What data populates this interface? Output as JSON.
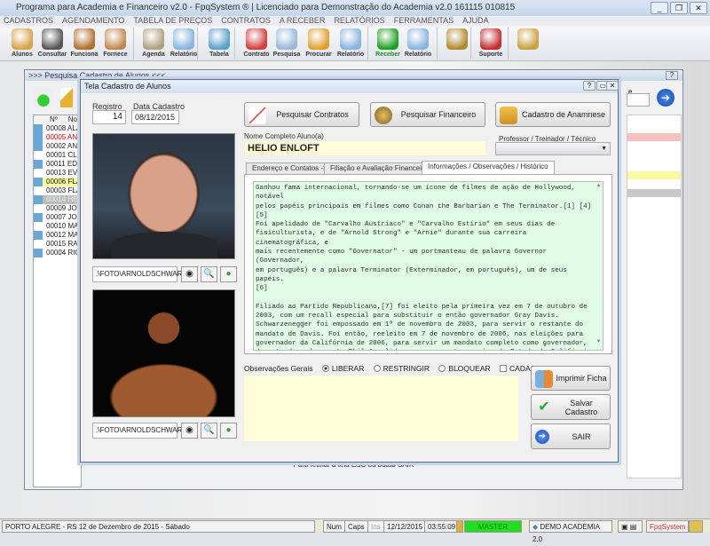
{
  "window": {
    "title": "Programa para Academia e Financeiro v2.0 - FpqSystem ® | Licenciado para  Demonstração do Academia v2.0 161115 010815"
  },
  "menu": [
    "CADASTROS",
    "AGENDAMENTO",
    "TABELA DE PREÇOS",
    "CONTRATOS",
    "A RECEBER",
    "RELATÓRIOS",
    "FERRAMENTAS",
    "AJUDA"
  ],
  "toolbar": [
    {
      "label": "Alunos",
      "icon": "students-icon",
      "color": "#d9a24a"
    },
    {
      "label": "Consultar",
      "icon": "id-card-icon",
      "color": "#555555"
    },
    {
      "label": "Funciona",
      "icon": "employees-icon",
      "color": "#b07030"
    },
    {
      "label": "Fornece",
      "icon": "supplier-icon",
      "color": "#c08850"
    },
    {
      "label": "Agenda",
      "icon": "clock-icon",
      "color": "#b0a080"
    },
    {
      "label": "Relatório",
      "icon": "printer-icon",
      "color": "#8ab4e0"
    },
    {
      "label": "Tabela",
      "icon": "document-icon",
      "color": "#5aa0c8"
    },
    {
      "label": "Contrato",
      "icon": "pen-icon",
      "color": "#d04040"
    },
    {
      "label": "Pesquisa",
      "icon": "magnifier-icon",
      "color": "#9ab8d8"
    },
    {
      "label": "Procurar",
      "icon": "folder-icon",
      "color": "#e0a030"
    },
    {
      "label": "Relatório",
      "icon": "printer-icon",
      "color": "#8ab4e0"
    },
    {
      "label": "Receber",
      "icon": "dollar-icon",
      "color": "#20a020"
    },
    {
      "label": "Relatório",
      "icon": "printer-icon",
      "color": "#8ab4e0"
    },
    {
      "label": "",
      "icon": "coins-icon",
      "color": "#b08830"
    },
    {
      "label": "Suporte",
      "icon": "support-icon",
      "color": "#c03030"
    },
    {
      "label": "",
      "icon": "exit-door-icon",
      "color": "#c8a040"
    }
  ],
  "search_window": {
    "title": ">>> Pesquisa Cadastro de Alunos <<<",
    "col_num": "Nº",
    "col_name": "Nom",
    "side_label": "e",
    "rows": [
      {
        "num": "00008",
        "name": "ALAN",
        "style": "normal"
      },
      {
        "num": "00005",
        "name": "ANAI",
        "style": "red"
      },
      {
        "num": "00002",
        "name": "ANGI",
        "style": "normal"
      },
      {
        "num": "00001",
        "name": "CLIEI",
        "style": "normal"
      },
      {
        "num": "00011",
        "name": "EDUA",
        "style": "normal"
      },
      {
        "num": "00013",
        "name": "EVER",
        "style": "normal"
      },
      {
        "num": "00006",
        "name": "FLAV",
        "style": "yellow"
      },
      {
        "num": "00003",
        "name": "FLAV",
        "style": "normal"
      },
      {
        "num": "00014",
        "name": "HELI",
        "style": "selected"
      },
      {
        "num": "00009",
        "name": "JOSE",
        "style": "normal"
      },
      {
        "num": "00007",
        "name": "JOÃO",
        "style": "normal"
      },
      {
        "num": "00010",
        "name": "MAIR",
        "style": "normal"
      },
      {
        "num": "00012",
        "name": "MATI",
        "style": "normal"
      },
      {
        "num": "00015",
        "name": "RAQI",
        "style": "normal"
      },
      {
        "num": "00004",
        "name": "RICA",
        "style": "normal"
      }
    ],
    "footer_hint": "Para fechar a tela ESC ou botão SAIR"
  },
  "dialog": {
    "title": "Tela Cadastro de Alunos",
    "registro_label": "Registro",
    "registro": "14",
    "data_label": "Data Cadastro",
    "data": "08/12/2015",
    "btn_contratos": "Pesquisar Contratos",
    "btn_financeiro": "Pesquisar Financeiro",
    "btn_anamnese": "Cadastro de Anamnese",
    "photo1_path": ".\\FOTO\\ARNOLDSCHWARZ",
    "photo2_path": ".\\FOTO\\ARNOLDSCHWARZ",
    "nome_label": "Nome Completo Aluno(a)",
    "nome": "HELIO ENLOFT",
    "professor_label": "Professor / Treinador / Técnico",
    "professor": "",
    "tabs": [
      "Endereço e Contatos ->",
      "Filiação e Avaliação Financeira ->",
      "Informações / Observações / Histórico"
    ],
    "active_tab": 2,
    "historico": "Ganhou fama internacional, tornando-se um ícone de filmes de ação de Hollywood, notável\npelos papéis principais em filmes como Conan the Barbarian e The Terminator.[1] [4] [5]\nFoi apelidado de \"Carvalho Austríaco\" e \"Carvalho Estírio\" em seus dias de\nfisiculturista, e de \"Arnold Strong\" e \"Arnie\" durante sua carreira cinematográfica, e\nmais recentemente como \"Governator\" - um portmanteau de palavra Governor (Governador,\nem português) e a palavra Terminator (Exterminador, em português), um de seus papéis.\n[6]\n\nFiliado ao Partido Republicano,[7] foi eleito pela primeira vez em 7 de outubro de\n2003, com um recall especial para substituir o então governador Gray Davis.\nSchwarzenegger foi empossado em 1º de novembro de 2003, para servir o restante do\nmandato de Davis. Foi então, reeleito em 7 de novembro de 2006, nas eleições para\ngovernador da Califórnia de 2006, para servir um mandato completo como governador,\nderrotando o democrata Phil Angelides, que era o tesoureiro de Estado da Califórnia na\népoca. Ele tomou posse para o segundo mandato em 5 de janeiro de 2007.[8] Em maio de\n2004 e 2007, foi nomeado como uma das 100 pessoas que ajudaram a moldar o mundo, pela\nrevista Time.[9] [10] Em 3 de janeiro de 2011 foi sucedido pelo democrata Jerry Brown.",
    "obs_label": "Observações Gerais",
    "radio_liberar": "LIBERAR",
    "radio_restringir": "RESTRINGIR",
    "radio_bloquear": "BLOQUEAR",
    "selected_radio": "LIBERAR",
    "chk_inativo": "CADASTRO INATIVO",
    "inativo": false,
    "observacoes": "",
    "btn_imprimir": "Imprimir Ficha",
    "btn_salvar": "Salvar Cadastro",
    "btn_sair": "SAIR"
  },
  "status": {
    "location": "PORTO ALEGRE - RS 12 de Dezembro de 2015 - Sábado",
    "num": "Num",
    "caps": "Caps",
    "ins": "Ins",
    "date": "12/12/2015",
    "time": "03:55:09",
    "user": "MASTER",
    "company": "DEMO ACADEMIA 2.0",
    "brand": "FpqSystem",
    "user_color": "#22dd22"
  }
}
